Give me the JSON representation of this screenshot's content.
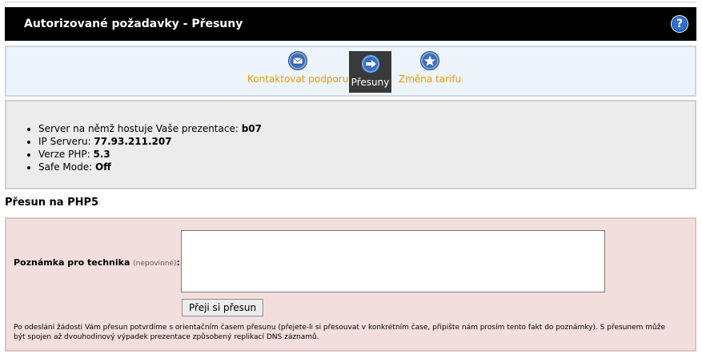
{
  "header": {
    "title": "Autorizované požadavky - Přesuny",
    "help_icon": "?"
  },
  "nav": {
    "items": [
      {
        "label": "Kontaktovat podporu",
        "icon": "mail-icon"
      },
      {
        "label": "Přesuny",
        "icon": "arrow-right-icon",
        "active": true
      },
      {
        "label": "Změna tarifu",
        "icon": "star-icon"
      }
    ]
  },
  "server_info": {
    "items": [
      {
        "label": "Server na němž hostuje Vaše prezentace: ",
        "value": "b07"
      },
      {
        "label": "IP Serveru: ",
        "value": "77.93.211.207"
      },
      {
        "label": "Verze PHP: ",
        "value": "5.3"
      },
      {
        "label": "Safe Mode: ",
        "value": "Off"
      }
    ]
  },
  "section": {
    "title": "Přesun na PHP5"
  },
  "form": {
    "note_label": "Poznámka pro technika",
    "note_optional": "(nepovinné)",
    "colon": ":",
    "note_value": "",
    "submit_label": "Přeji si přesun",
    "footnote": "Po odeslání žádosti Vám přesun potvrdíme s orientačním časem přesunu (přejete-li si přesouvat v konkrétním čase, připište nám prosím tento fakt do poznámky). S přesunem může být spojen až dvouhodinový výpadek prezentace způsobený replikací DNS záznamů."
  },
  "colors": {
    "nav_link": "#e59a12",
    "header_bg": "#000000",
    "form_bg": "#f3dede",
    "info_bg": "#ececec"
  }
}
